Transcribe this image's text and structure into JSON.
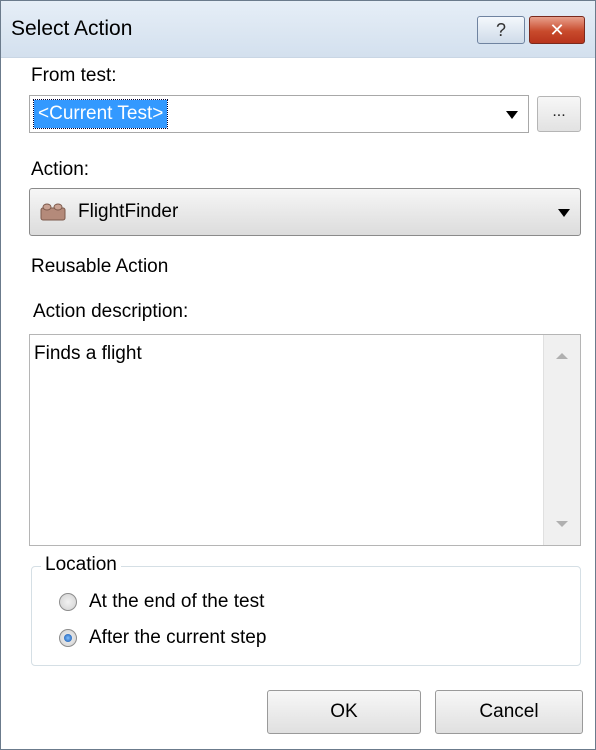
{
  "window": {
    "title": "Select Action",
    "help_label": "?",
    "close_label": "✕"
  },
  "from_test": {
    "label": "From test:",
    "value": "<Current Test>",
    "browse_label": "..."
  },
  "action": {
    "label": "Action:",
    "value": "FlightFinder",
    "icon": "action-block-icon"
  },
  "reusable_text": "Reusable Action",
  "description": {
    "label": "Action description:",
    "text": "Finds a flight"
  },
  "location": {
    "legend": "Location",
    "options": [
      {
        "label": "At the end of the test",
        "checked": false
      },
      {
        "label": "After the current step",
        "checked": true
      }
    ]
  },
  "buttons": {
    "ok": "OK",
    "cancel": "Cancel"
  }
}
